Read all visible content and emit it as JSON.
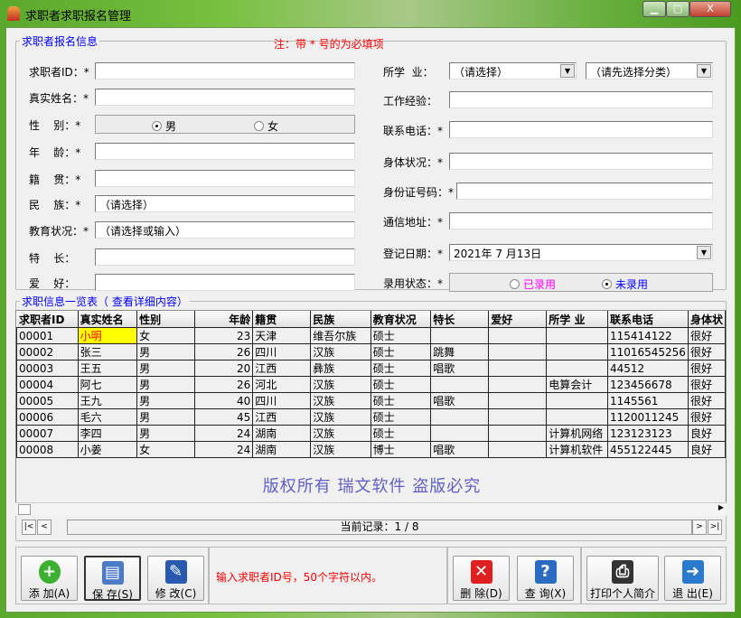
{
  "window": {
    "title": "求职者求职报名管理",
    "min": "▁",
    "max": "□",
    "close": "X"
  },
  "form": {
    "legend": "求职者报名信息",
    "note": "注：带 * 号的为必填项",
    "left": [
      {
        "label": "求职者ID：*",
        "value": ""
      },
      {
        "label": "真实姓名：*",
        "value": ""
      },
      {
        "label": "性    别：*"
      },
      {
        "label": "年    龄：*",
        "value": ""
      },
      {
        "label": "籍    贯：*",
        "value": ""
      },
      {
        "label": "民    族：*",
        "value": "（请选择）"
      },
      {
        "label": "教育状况：*",
        "value": "（请选择或输入）"
      },
      {
        "label": "特    长：",
        "value": ""
      },
      {
        "label": "爱    好：",
        "value": ""
      }
    ],
    "gender": {
      "male": "男",
      "female": "女",
      "selected": "男"
    },
    "right": [
      {
        "label": "所学  业：",
        "value": "（请选择）",
        "value2": "（请先选择分类）"
      },
      {
        "label": "工作经验：",
        "value": ""
      },
      {
        "label": "联系电话：*",
        "value": ""
      },
      {
        "label": "身体状况：*",
        "value": ""
      },
      {
        "label": "身份证号码：*",
        "value": ""
      },
      {
        "label": "通信地址：*",
        "value": ""
      },
      {
        "label": "登记日期：*",
        "value": "2021年 7 月13日"
      },
      {
        "label": "录用状态：*"
      }
    ],
    "status": {
      "hired": "已录用",
      "not_hired": "未录用",
      "selected": "未录用",
      "hired_color": "#ff00ff",
      "not_hired_color": "#0000ff"
    }
  },
  "list": {
    "legend": "求职信息一览表（    查看详细内容）",
    "columns": [
      "求职者ID",
      "真实姓名",
      "性别",
      "年龄",
      "籍贯",
      "民族",
      "教育状况",
      "特长",
      "爱好",
      "所学  业",
      "联系电话",
      "身体状"
    ],
    "rows": [
      [
        "00001",
        "小明",
        "女",
        "23",
        "天津",
        "维吾尔族",
        "硕士",
        "",
        "",
        "",
        "115414122",
        "很好"
      ],
      [
        "00002",
        "张三",
        "男",
        "26",
        "四川",
        "汉族",
        "硕士",
        "跳舞",
        "",
        "",
        "11016545256",
        "很好"
      ],
      [
        "00003",
        "王五",
        "男",
        "20",
        "江西",
        "彝族",
        "硕士",
        "唱歌",
        "",
        "",
        "44512",
        "很好"
      ],
      [
        "00004",
        "阿七",
        "男",
        "26",
        "河北",
        "汉族",
        "硕士",
        "",
        "",
        "电算会计",
        "123456678",
        "很好"
      ],
      [
        "00005",
        "王九",
        "男",
        "40",
        "四川",
        "汉族",
        "硕士",
        "唱歌",
        "",
        "",
        "1145561",
        "很好"
      ],
      [
        "00006",
        "毛六",
        "男",
        "45",
        "江西",
        "汉族",
        "硕士",
        "",
        "",
        "",
        "1120011245",
        "很好"
      ],
      [
        "00007",
        "李四",
        "男",
        "24",
        "湖南",
        "汉族",
        "硕士",
        "",
        "",
        "计算机网络",
        "123123123",
        "良好"
      ],
      [
        "00008",
        "小姜",
        "女",
        "24",
        "湖南",
        "汉族",
        "博士",
        "唱歌",
        "",
        "计算机软件",
        "455122445",
        "良好"
      ]
    ],
    "watermark": "版权所有  瑞文软件  盗版必究",
    "record": "当前记录：1 / 8",
    "nav": {
      "first": "|<",
      "prev": "<",
      "next": ">",
      "last": ">|"
    }
  },
  "toolbar": {
    "add": "添 加(A)",
    "save": "保 存(S)",
    "edit": "修 改(C)",
    "hint": "输入求职者ID号，50个字符以内。",
    "delete": "删 除(D)",
    "query": "查 询(X)",
    "print": "打印个人简介",
    "exit": "退 出(E)"
  }
}
